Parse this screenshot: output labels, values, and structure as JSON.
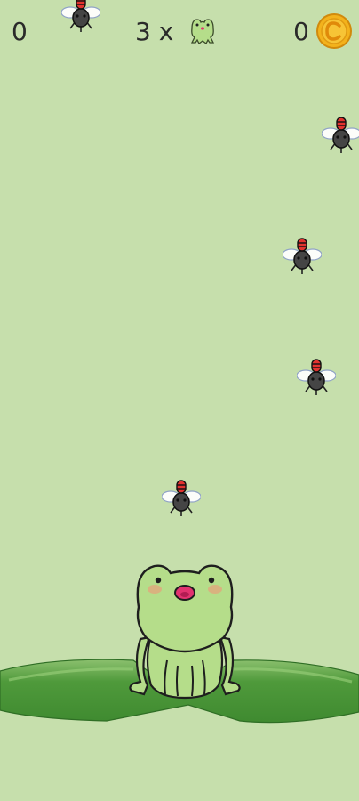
{
  "hud": {
    "score": "0",
    "lives": "3 x",
    "coins": "0"
  },
  "icons": {
    "life": "mini-frog-icon",
    "coin": "coin-icon",
    "fly": "fly-icon"
  },
  "colors": {
    "background": "#c6dfac",
    "frog": "#b5dd8a",
    "lily_pad": "#4f9a3b",
    "coin": "#f3b21c",
    "fly_body": "#3c3c3c",
    "fly_head": "#e2332f"
  }
}
